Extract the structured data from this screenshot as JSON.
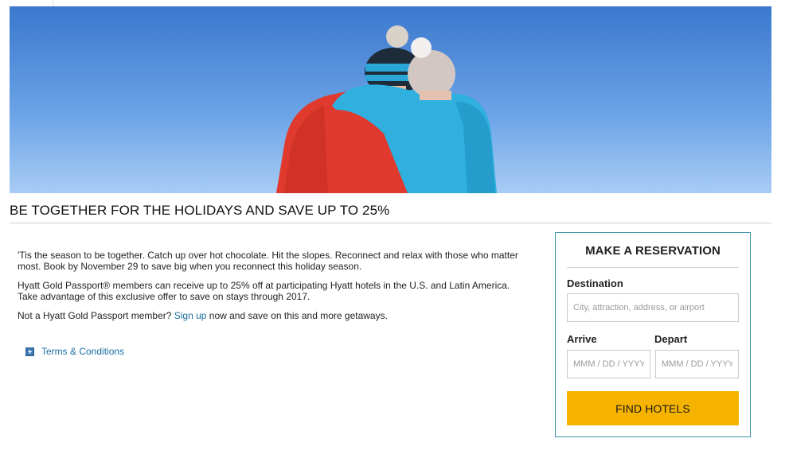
{
  "hero": {
    "image_description": "couple-hugging-winter-hats-blue-sky",
    "colors": {
      "sky": "#5b93dc",
      "jacket_left": "#e8382e",
      "jacket_right": "#29a9d8"
    }
  },
  "promo": {
    "headline": "BE TOGETHER FOR THE HOLIDAYS AND SAVE UP TO 25%",
    "paragraph_1": "'Tis the season to be together. Catch up over hot chocolate. Hit the slopes. Reconnect and relax with those who matter most. Book by November 29 to save big when you reconnect this holiday season.",
    "paragraph_2": "Hyatt Gold Passport® members can receive up to 25% off at participating Hyatt hotels in the U.S. and Latin America. Take advantage of this exclusive offer to save on stays through 2017.",
    "paragraph_3_before": "Not a Hyatt Gold Passport member? ",
    "paragraph_3_link": "Sign up",
    "paragraph_3_after": " now and save on this and more getaways.",
    "terms_label": "Terms & Conditions",
    "terms_icon": "plus-icon"
  },
  "reservation": {
    "title": "MAKE A RESERVATION",
    "destination_label": "Destination",
    "destination_placeholder": "City, attraction, address, or airport",
    "arrive_label": "Arrive",
    "arrive_placeholder": "MMM / DD / YYYY",
    "depart_label": "Depart",
    "depart_placeholder": "MMM / DD / YYYY",
    "button_label": "FIND HOTELS",
    "button_color": "#f5b300",
    "border_color": "#3a8fa6",
    "link_color": "#1a6fa3"
  }
}
